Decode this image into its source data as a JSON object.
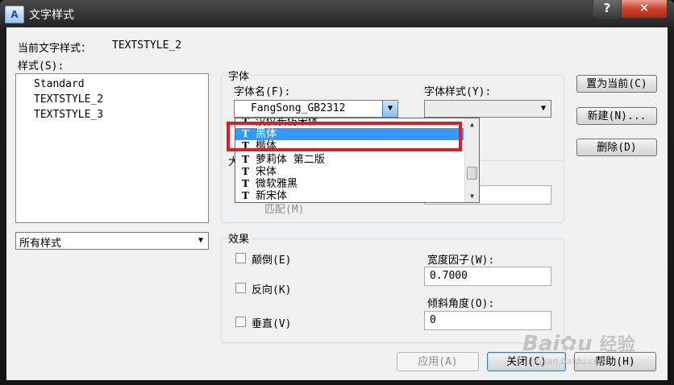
{
  "window": {
    "title": "文字样式",
    "icon_label": "A",
    "help_label": "?",
    "close_label": "✕"
  },
  "current_style": {
    "label": "当前文字样式：",
    "value": "TEXTSTYLE_2"
  },
  "styles": {
    "label": "样式(S):",
    "items": [
      "Standard",
      "TEXTSTYLE_2",
      "TEXTSTYLE_3"
    ],
    "filter_value": "所有样式"
  },
  "font_group": {
    "legend": "字体",
    "font_name_label": "字体名(F):",
    "font_name_value": "FangSong_GB2312",
    "font_style_label": "字体样式(Y):",
    "font_style_value": "",
    "dropdown_items": [
      {
        "icon": "T",
        "name": "汉仪长仿宋体",
        "selected": false
      },
      {
        "icon": "T",
        "name": "黑体",
        "selected": true
      },
      {
        "icon": "T",
        "name": "楷体",
        "selected": false
      },
      {
        "icon": "T",
        "name": "萝莉体 第二版",
        "selected": false
      },
      {
        "icon": "T",
        "name": "宋体",
        "selected": false
      },
      {
        "icon": "T",
        "name": "微软雅黑",
        "selected": false
      },
      {
        "icon": "T",
        "name": "新宋体",
        "selected": false
      }
    ]
  },
  "size_group": {
    "legend": "大",
    "match_label": "匹配(M)"
  },
  "effects": {
    "legend": "效果",
    "upside_down": {
      "label": "颠倒(E)",
      "checked": false
    },
    "backwards": {
      "label": "反向(K)",
      "checked": false
    },
    "vertical": {
      "label": "垂直(V)",
      "checked": false
    },
    "width_factor_label": "宽度因子(W):",
    "width_factor_value": "0.7000",
    "oblique_label": "倾斜角度(O):",
    "oblique_value": "0"
  },
  "buttons": {
    "set_current": "置为当前(C)",
    "new": "新建(N)...",
    "delete": "删除(D)",
    "apply": "应用(A)",
    "close": "关闭(C)",
    "help": "帮助(H)"
  },
  "watermark": {
    "text": "Bai",
    "text2": "经验",
    "url": "jingyan.baidu.com"
  }
}
